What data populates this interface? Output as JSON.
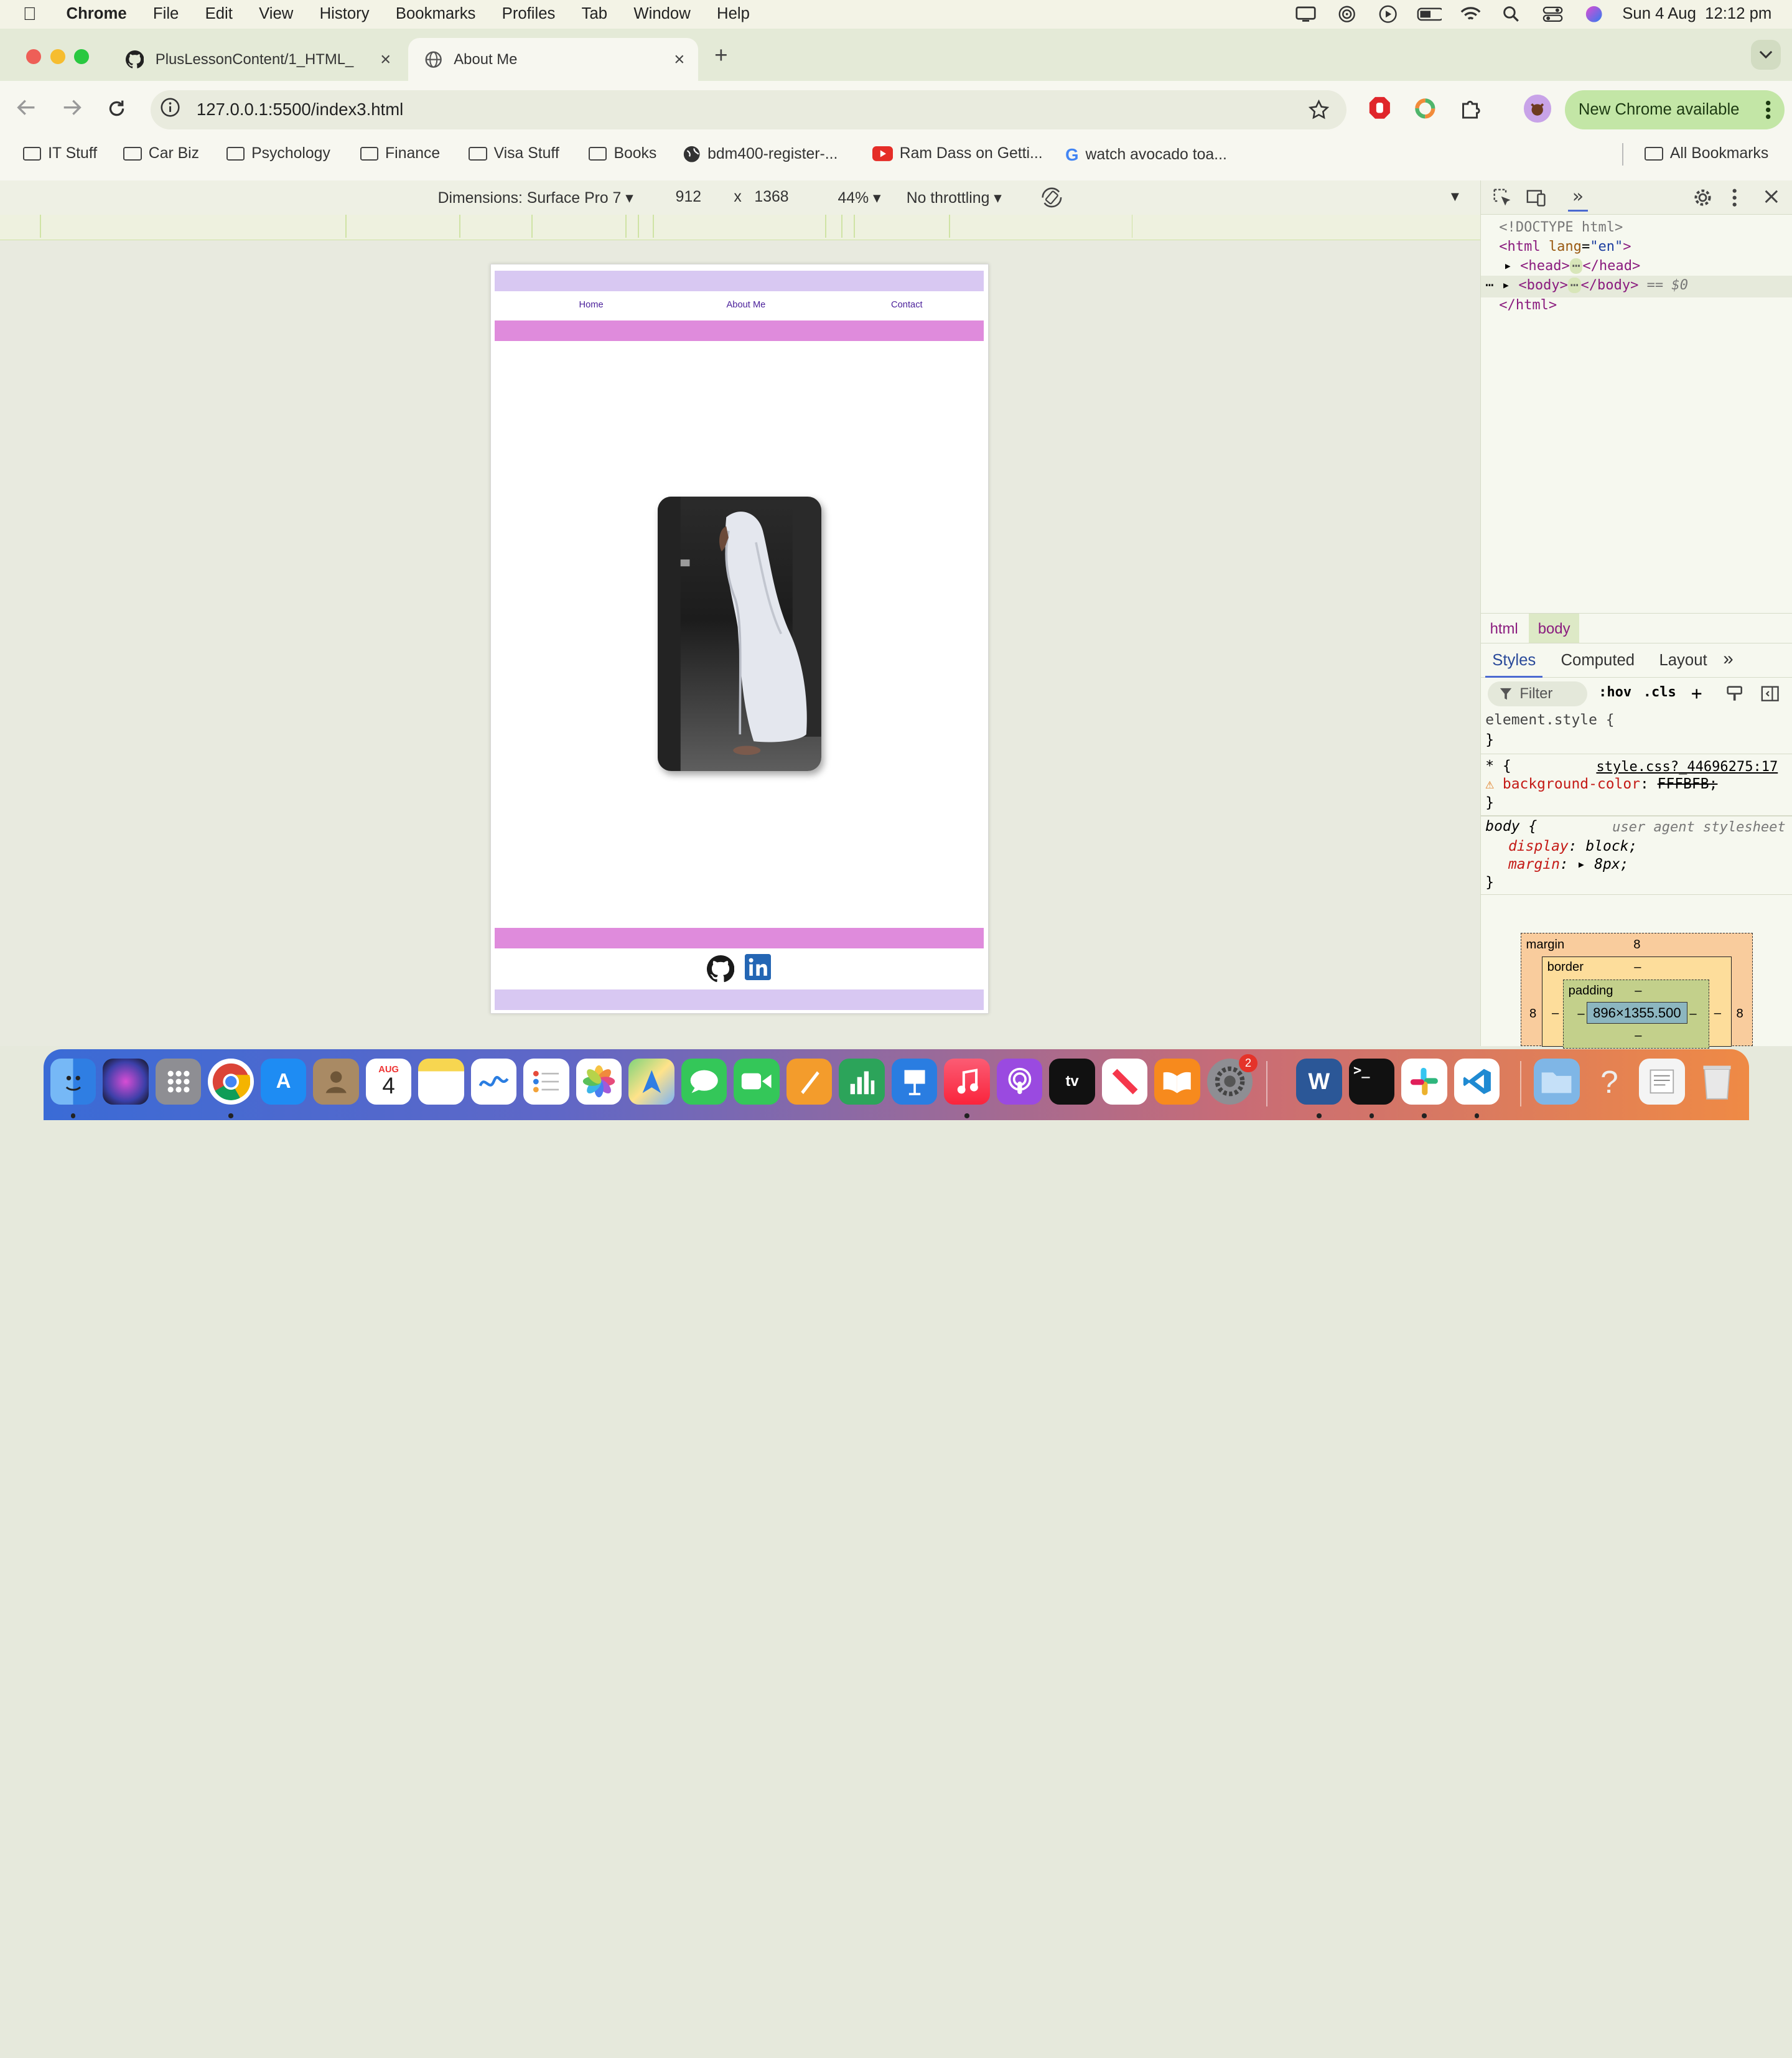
{
  "menubar": {
    "app": "Chrome",
    "items": [
      "File",
      "Edit",
      "View",
      "History",
      "Bookmarks",
      "Profiles",
      "Tab",
      "Window",
      "Help"
    ],
    "datetime": "Sun 4 Aug  12:12 pm"
  },
  "tabs": [
    {
      "title": "PlusLessonContent/1_HTML_",
      "icon": "github-icon",
      "close": "×"
    },
    {
      "title": "About Me",
      "icon": "globe-icon",
      "close": "×"
    }
  ],
  "newtab": "+",
  "toolbar": {
    "url": "127.0.0.1:5500/index3.html",
    "new_chrome": "New Chrome available"
  },
  "bookmarks": {
    "items": [
      "IT Stuff",
      "Car Biz",
      "Psychology",
      "Finance",
      "Visa Stuff",
      "Books",
      "bdm400-register-...",
      "Ram Dass on Getti...",
      "watch avocado toa..."
    ],
    "all": "All Bookmarks"
  },
  "devbar": {
    "dimensions": "Dimensions: Surface Pro 7",
    "width": "912",
    "times": "x",
    "height": "1368",
    "zoom": "44%",
    "throttle": "No throttling"
  },
  "site": {
    "nav": [
      "Home",
      "About Me",
      "Contact"
    ],
    "colors": {
      "lavender": "#d8c8f2",
      "pink": "#df8bdc",
      "link": "#4a1f9a"
    }
  },
  "devtools": {
    "doctype": "<!DOCTYPE html>",
    "html_open_tag": "<html",
    "lang_attr": "lang",
    "lang_value": "\"en\"",
    "html_open_end": ">",
    "head_tag": "<head>",
    "head_close": "</head>",
    "body_tag": "<body>",
    "body_close": "</body>",
    "dollar": "== $0",
    "html_close": "</html>",
    "crumbs": [
      "html",
      "body"
    ],
    "panes": [
      "Styles",
      "Computed",
      "Layout"
    ],
    "filter": "Filter",
    "hov": ":hov",
    "cls": ".cls",
    "element_style": "element.style {",
    "close_brace": "}",
    "star_rule": "* {",
    "star_source": "style.css?_44696275:17",
    "bg_prop": "background-color",
    "bg_val": "FFFBFB;",
    "body_rule": "body {",
    "ua": "user agent stylesheet",
    "display_prop": "display",
    "display_val": "block;",
    "margin_prop": "margin",
    "margin_val": "8px;",
    "box": {
      "margin_label": "margin",
      "margin": "8",
      "border_label": "border",
      "border": "–",
      "padding_label": "padding",
      "padding": "–",
      "content": "896×1355.500",
      "side": "8",
      "dash": "–"
    }
  },
  "dock": {
    "calendar_month": "AUG",
    "calendar_day": "4",
    "badge": "2"
  }
}
